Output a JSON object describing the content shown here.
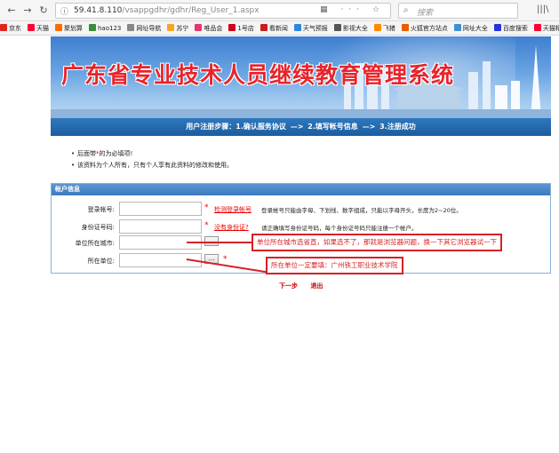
{
  "browser": {
    "url_host": "59.41.8.110",
    "url_path": "/vsappgdhr/gdhr/Reg_User_1.aspx",
    "search_placeholder": "搜索",
    "url_icons": "▦ ··· ☆",
    "bookmarks": [
      {
        "label": "京东",
        "color": "#e1251b"
      },
      {
        "label": "天猫",
        "color": "#ff0036"
      },
      {
        "label": "聚划算",
        "color": "#ff6a00"
      },
      {
        "label": "hao123",
        "color": "#3a8e3a"
      },
      {
        "label": "网址导航",
        "color": "#888888"
      },
      {
        "label": "苏宁",
        "color": "#f5a623"
      },
      {
        "label": "唯品会",
        "color": "#e6356f"
      },
      {
        "label": "1号店",
        "color": "#d0021b"
      },
      {
        "label": "看新闻",
        "color": "#c81e1e"
      },
      {
        "label": "天气预报",
        "color": "#2e86de"
      },
      {
        "label": "影视大全",
        "color": "#555555"
      },
      {
        "label": "飞猪",
        "color": "#ff8a00"
      },
      {
        "label": "火狐官方站点",
        "color": "#e66000"
      },
      {
        "label": "网址大全",
        "color": "#3f8fd2"
      },
      {
        "label": "百度搜索",
        "color": "#2932e1"
      },
      {
        "label": "天猫精选",
        "color": "#ff0036"
      }
    ]
  },
  "banner": {
    "title": "广东省专业技术人员继续教育管理系统"
  },
  "steps": {
    "prefix": "用户注册步骤：",
    "step1": "1.确认服务协议",
    "arrow": "—>",
    "step2": "2.填写帐号信息",
    "step3": "3.注册成功"
  },
  "notes": {
    "n1_pre": "后面带",
    "n1_star": "*",
    "n1_post": "的为必填项!",
    "n2": "该资料为个人所有，只有个人享有此资料的修改和使用。"
  },
  "form": {
    "header": "帐户信息",
    "rows": [
      {
        "label": "登录帐号:",
        "required": "*",
        "link": "检测登录帐号",
        "hint": "登录帐号只能由字母、下划线、数字组成，只能以字母开头，长度为2~20位。"
      },
      {
        "label": "身份证号码:",
        "required": "*",
        "link": "没有身份证?",
        "hint": "请正确填写身份证号码，每个身份证号码只能注册一个帐户。"
      },
      {
        "label": "单位所在城市:",
        "picker": "..."
      },
      {
        "label": "所在单位:",
        "picker": "...",
        "required": "*"
      }
    ]
  },
  "actions": {
    "next": "下一步",
    "exit": "退出"
  },
  "annotations": {
    "a1": "单位所在城市选省直，如果选不了，那就是浏览器问题，换一下其它浏览器试一下",
    "a2": "所在单位一定要填：广州铁工职业技术学院"
  },
  "colors": {
    "annotation": "#d62126",
    "title_red": "#e8242b",
    "header_blue": "#2f78bd"
  }
}
